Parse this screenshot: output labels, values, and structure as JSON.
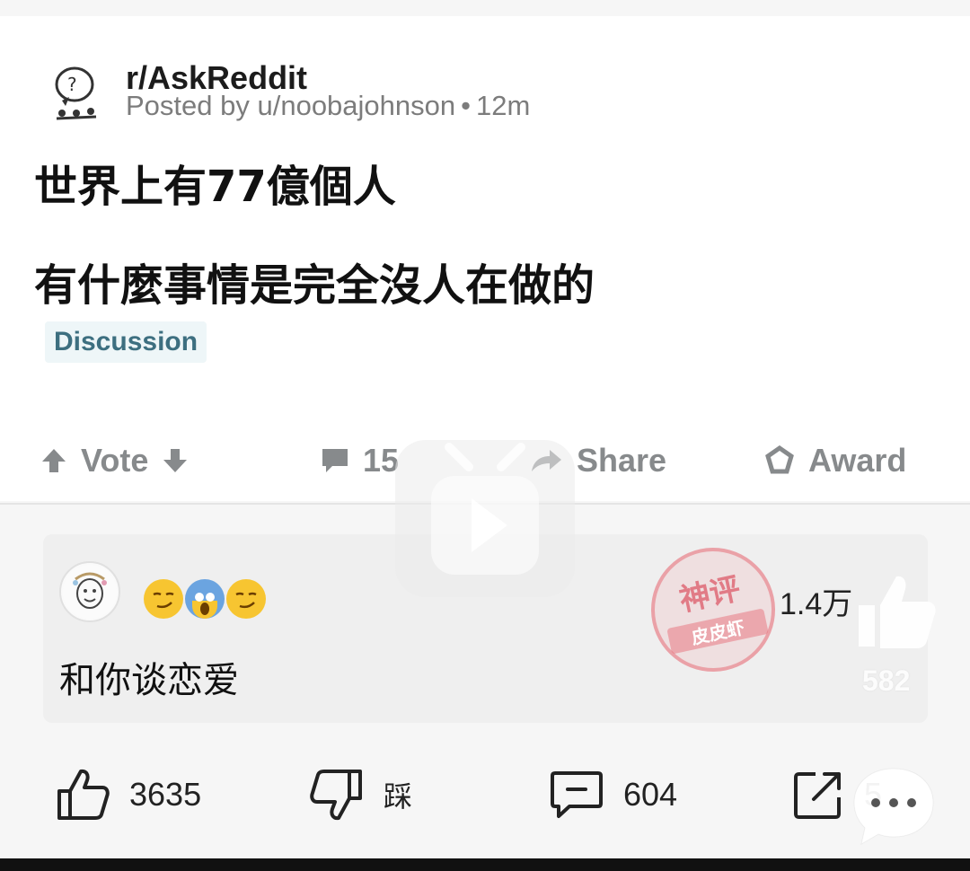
{
  "post": {
    "subreddit": "r/AskReddit",
    "posted_by": "Posted by u/noobajohnson",
    "time_ago": "12m",
    "title_line1": "世界上有77億個人",
    "title_line2": "有什麼事情是完全沒人在做的",
    "flair": "Discussion",
    "actions": {
      "vote": "Vote",
      "comments": "15",
      "share": "Share",
      "award": "Award"
    }
  },
  "comment": {
    "emojis": [
      "smirking-face",
      "screaming-face",
      "smirking-face"
    ],
    "likes": "1.4万",
    "text": "和你谈恋爱"
  },
  "stamp": {
    "line1": "神评",
    "line2": "皮皮虾"
  },
  "side_like": {
    "count": "582"
  },
  "bottom_bar": {
    "likes": "3635",
    "dislike_label": "踩",
    "comments": "604",
    "share_count": "5"
  },
  "colors": {
    "flair_text": "#3d6f80",
    "meta_gray": "#7c7c7c",
    "action_gray": "#878a8c",
    "stamp_red": "#dc505f"
  }
}
